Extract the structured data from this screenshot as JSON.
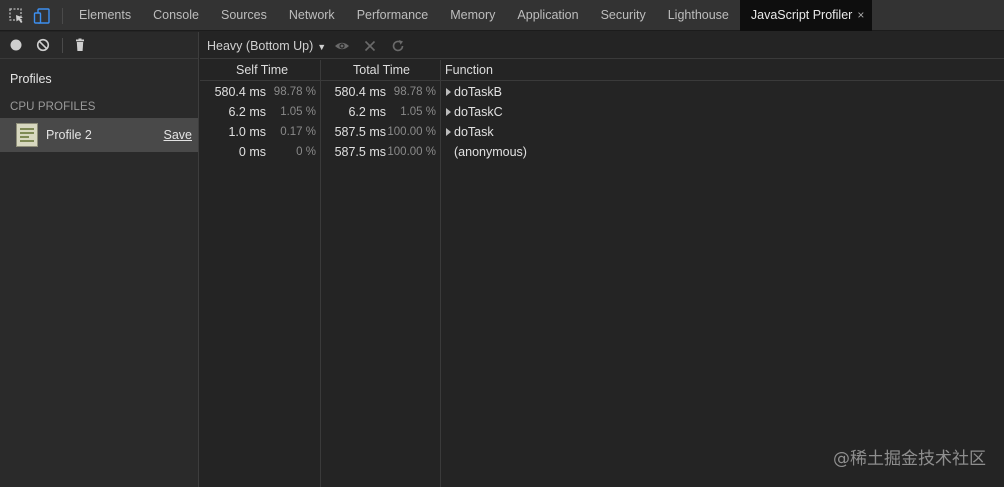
{
  "tabs": [
    {
      "label": "Elements"
    },
    {
      "label": "Console"
    },
    {
      "label": "Sources"
    },
    {
      "label": "Network"
    },
    {
      "label": "Performance"
    },
    {
      "label": "Memory"
    },
    {
      "label": "Application"
    },
    {
      "label": "Security"
    },
    {
      "label": "Lighthouse"
    },
    {
      "label": "JavaScript Profiler",
      "active": true,
      "close": "×"
    }
  ],
  "sidebar": {
    "title": "Profiles",
    "section": "CPU PROFILES",
    "profile": {
      "name": "Profile 2",
      "save_label": "Save"
    }
  },
  "toolbar": {
    "mode": "Heavy (Bottom Up)"
  },
  "table": {
    "columns": [
      "Self Time",
      "Total Time",
      "Function"
    ],
    "rows": [
      {
        "self_ms": "580.4 ms",
        "self_pct": "98.78 %",
        "total_ms": "580.4 ms",
        "total_pct": "98.78 %",
        "fn": "doTaskB",
        "expandable": true
      },
      {
        "self_ms": "6.2 ms",
        "self_pct": "1.05 %",
        "total_ms": "6.2 ms",
        "total_pct": "1.05 %",
        "fn": "doTaskC",
        "expandable": true
      },
      {
        "self_ms": "1.0 ms",
        "self_pct": "0.17 %",
        "total_ms": "587.5 ms",
        "total_pct": "100.00 %",
        "fn": "doTask",
        "expandable": true
      },
      {
        "self_ms": "0 ms",
        "self_pct": "0 %",
        "total_ms": "587.5 ms",
        "total_pct": "100.00 %",
        "fn": "(anonymous)",
        "expandable": false
      }
    ]
  },
  "watermark": "@稀土掘金技术社区",
  "colors": {
    "active_tab_bg": "#0e0e0e",
    "selected_profile_bg": "#494949",
    "record_button": "#cfcfcf"
  }
}
